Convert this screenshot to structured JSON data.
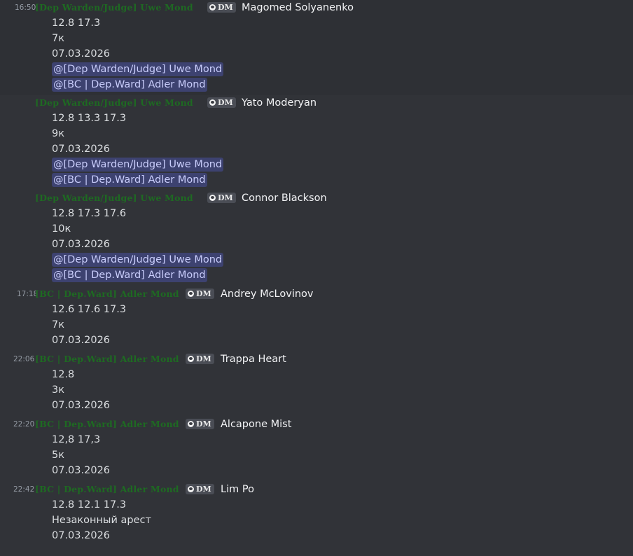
{
  "messages": [
    {
      "time": "16:50",
      "author": "[Dep Warden/Judge] Uwe Mond",
      "badge": "DM",
      "subject": "Magomed Solyanenko",
      "lines": [
        "12.8 17.3",
        "7к",
        "07.03.2026"
      ],
      "mentions": [
        "@[Dep Warden/Judge] Uwe Mond",
        "@[BC | Dep.Ward] Adler Mond"
      ]
    },
    {
      "time": "",
      "author": "[Dep Warden/Judge] Uwe Mond",
      "badge": "DM",
      "subject": "Yato Moderyan",
      "lines": [
        "12.8 13.3 17.3",
        "9к",
        "07.03.2026"
      ],
      "mentions": [
        "@[Dep Warden/Judge] Uwe Mond",
        "@[BC | Dep.Ward] Adler Mond"
      ]
    },
    {
      "time": "",
      "author": "[Dep Warden/Judge] Uwe Mond",
      "badge": "DM",
      "subject": "Connor Blackson",
      "lines": [
        "12.8 17.3 17.6",
        "10к",
        "07.03.2026"
      ],
      "mentions": [
        "@[Dep Warden/Judge] Uwe Mond",
        "@[BC | Dep.Ward] Adler Mond"
      ]
    },
    {
      "time": "17:18",
      "author": "[BC | Dep.Ward] Adler Mond",
      "badge": "DM",
      "subject": "Andrey McLovinov",
      "lines": [
        "12.6 17.6 17.3",
        "7к",
        "07.03.2026"
      ],
      "mentions": []
    },
    {
      "time": "22:06",
      "author": "[BC | Dep.Ward] Adler Mond",
      "badge": "DM",
      "subject": "Trappa Heart",
      "lines": [
        "12.8",
        "3к",
        "07.03.2026"
      ],
      "mentions": []
    },
    {
      "time": "22:20",
      "author": "[BC | Dep.Ward] Adler Mond",
      "badge": "DM",
      "subject": "Alcapone Mist",
      "lines": [
        "12,8 17,3",
        "5к",
        "07.03.2026"
      ],
      "mentions": []
    },
    {
      "time": "22:42",
      "author": "[BC | Dep.Ward] Adler Mond",
      "badge": "DM",
      "subject": "Lim Po",
      "lines": [
        "12.8 12.1 17.3",
        "Незаконный арест",
        "07.03.2026"
      ],
      "mentions": []
    }
  ],
  "colors": {
    "background": "#313338",
    "hover_background": "#2e3035",
    "author": "#1e6a22",
    "mention_bg": "#3d4270",
    "mention_text": "#c9cdfb"
  },
  "icons": {
    "badge": "mask-icon"
  }
}
